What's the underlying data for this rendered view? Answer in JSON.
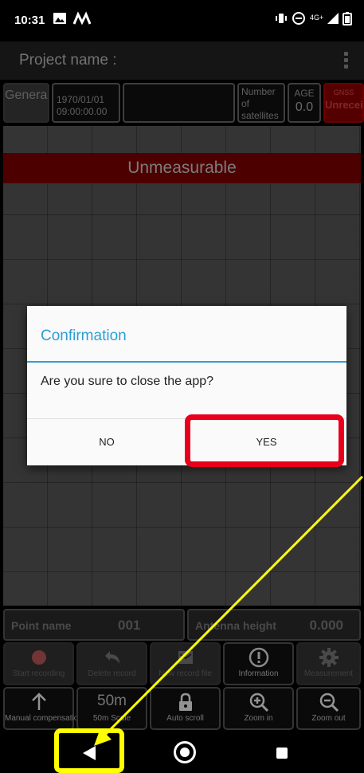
{
  "status_bar": {
    "time": "10:31",
    "icons": [
      "image-icon",
      "m-logo-icon",
      "vibrate-icon",
      "do-not-disturb-icon",
      "signal-4g-icon",
      "battery-icon"
    ],
    "network_label": "4G+"
  },
  "app_bar": {
    "title": "Project name :"
  },
  "info_row": {
    "general_label": "General",
    "datetime_label": "1970/01/01 09:00:00.00",
    "satellites_label": "Number of satellites",
    "age_label": "AGE",
    "age_value": "0.0",
    "gnss_label": "GNSS",
    "gnss_value": "Unreceived"
  },
  "graph": {
    "banner": "Unmeasurable"
  },
  "dialog": {
    "title": "Confirmation",
    "message": "Are you sure to close the app?",
    "no_label": "NO",
    "yes_label": "YES"
  },
  "point_row": {
    "point_label": "Point name",
    "point_value": "001",
    "antenna_label": "Antenna height",
    "antenna_value": "0.000"
  },
  "toolbar_row1": [
    {
      "label": "Start recording",
      "icon": "record-icon",
      "enabled": false
    },
    {
      "label": "Delete record",
      "icon": "undo-icon",
      "enabled": false
    },
    {
      "label": "New record file",
      "icon": "new-file-icon",
      "enabled": false
    },
    {
      "label": "Information",
      "icon": "info-icon",
      "enabled": true
    },
    {
      "label": "Measurement",
      "icon": "gear-icon",
      "enabled": false
    }
  ],
  "toolbar_row2": [
    {
      "label": "Manual compensation",
      "icon": "arrow-up-icon"
    },
    {
      "label": "50m Scale",
      "value": "50m",
      "icon": "scale-icon"
    },
    {
      "label": "Auto scroll",
      "icon": "lock-icon"
    },
    {
      "label": "Zoom in",
      "icon": "zoom-in-icon"
    },
    {
      "label": "Zoom out",
      "icon": "zoom-out-icon"
    }
  ],
  "colors": {
    "accent": "#2b9fd6",
    "alert_red": "#7b0000",
    "highlight_red": "#e8001b",
    "highlight_yellow": "#ffff00"
  }
}
